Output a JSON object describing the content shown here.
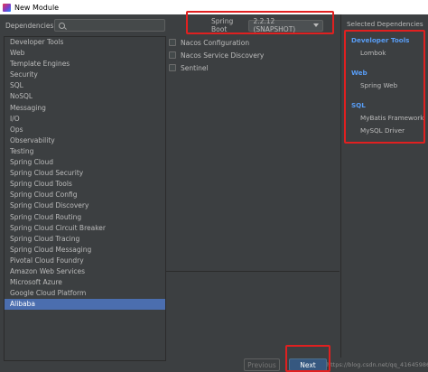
{
  "window": {
    "title": "New Module"
  },
  "dependencies_label": "Dependencies",
  "search": {
    "placeholder": ""
  },
  "categories": [
    "Developer Tools",
    "Web",
    "Template Engines",
    "Security",
    "SQL",
    "NoSQL",
    "Messaging",
    "I/O",
    "Ops",
    "Observability",
    "Testing",
    "Spring Cloud",
    "Spring Cloud Security",
    "Spring Cloud Tools",
    "Spring Cloud Config",
    "Spring Cloud Discovery",
    "Spring Cloud Routing",
    "Spring Cloud Circuit Breaker",
    "Spring Cloud Tracing",
    "Spring Cloud Messaging",
    "Pivotal Cloud Foundry",
    "Amazon Web Services",
    "Microsoft Azure",
    "Google Cloud Platform",
    "Alibaba"
  ],
  "selected_category": "Alibaba",
  "spring_boot": {
    "label": "Spring Boot",
    "version": "2.2.12 (SNAPSHOT)"
  },
  "dependency_options": [
    {
      "label": "Nacos Configuration",
      "checked": false
    },
    {
      "label": "Nacos Service Discovery",
      "checked": false
    },
    {
      "label": "Sentinel",
      "checked": false
    }
  ],
  "selected_dependencies": {
    "header": "Selected Dependencies",
    "groups": [
      {
        "title": "Developer Tools",
        "items": [
          "Lombok"
        ]
      },
      {
        "title": "Web",
        "items": [
          "Spring Web"
        ]
      },
      {
        "title": "SQL",
        "items": [
          "MyBatis Framework",
          "MySQL Driver"
        ]
      }
    ]
  },
  "buttons": {
    "previous": "Previous",
    "next": "Next"
  },
  "watermark": "https://blog.csdn.net/qq_41645986",
  "colors": {
    "background": "#3c3f41",
    "selection": "#4b6eaf",
    "group_title": "#589df6",
    "highlight": "#e02020",
    "next_button": "#365880"
  }
}
